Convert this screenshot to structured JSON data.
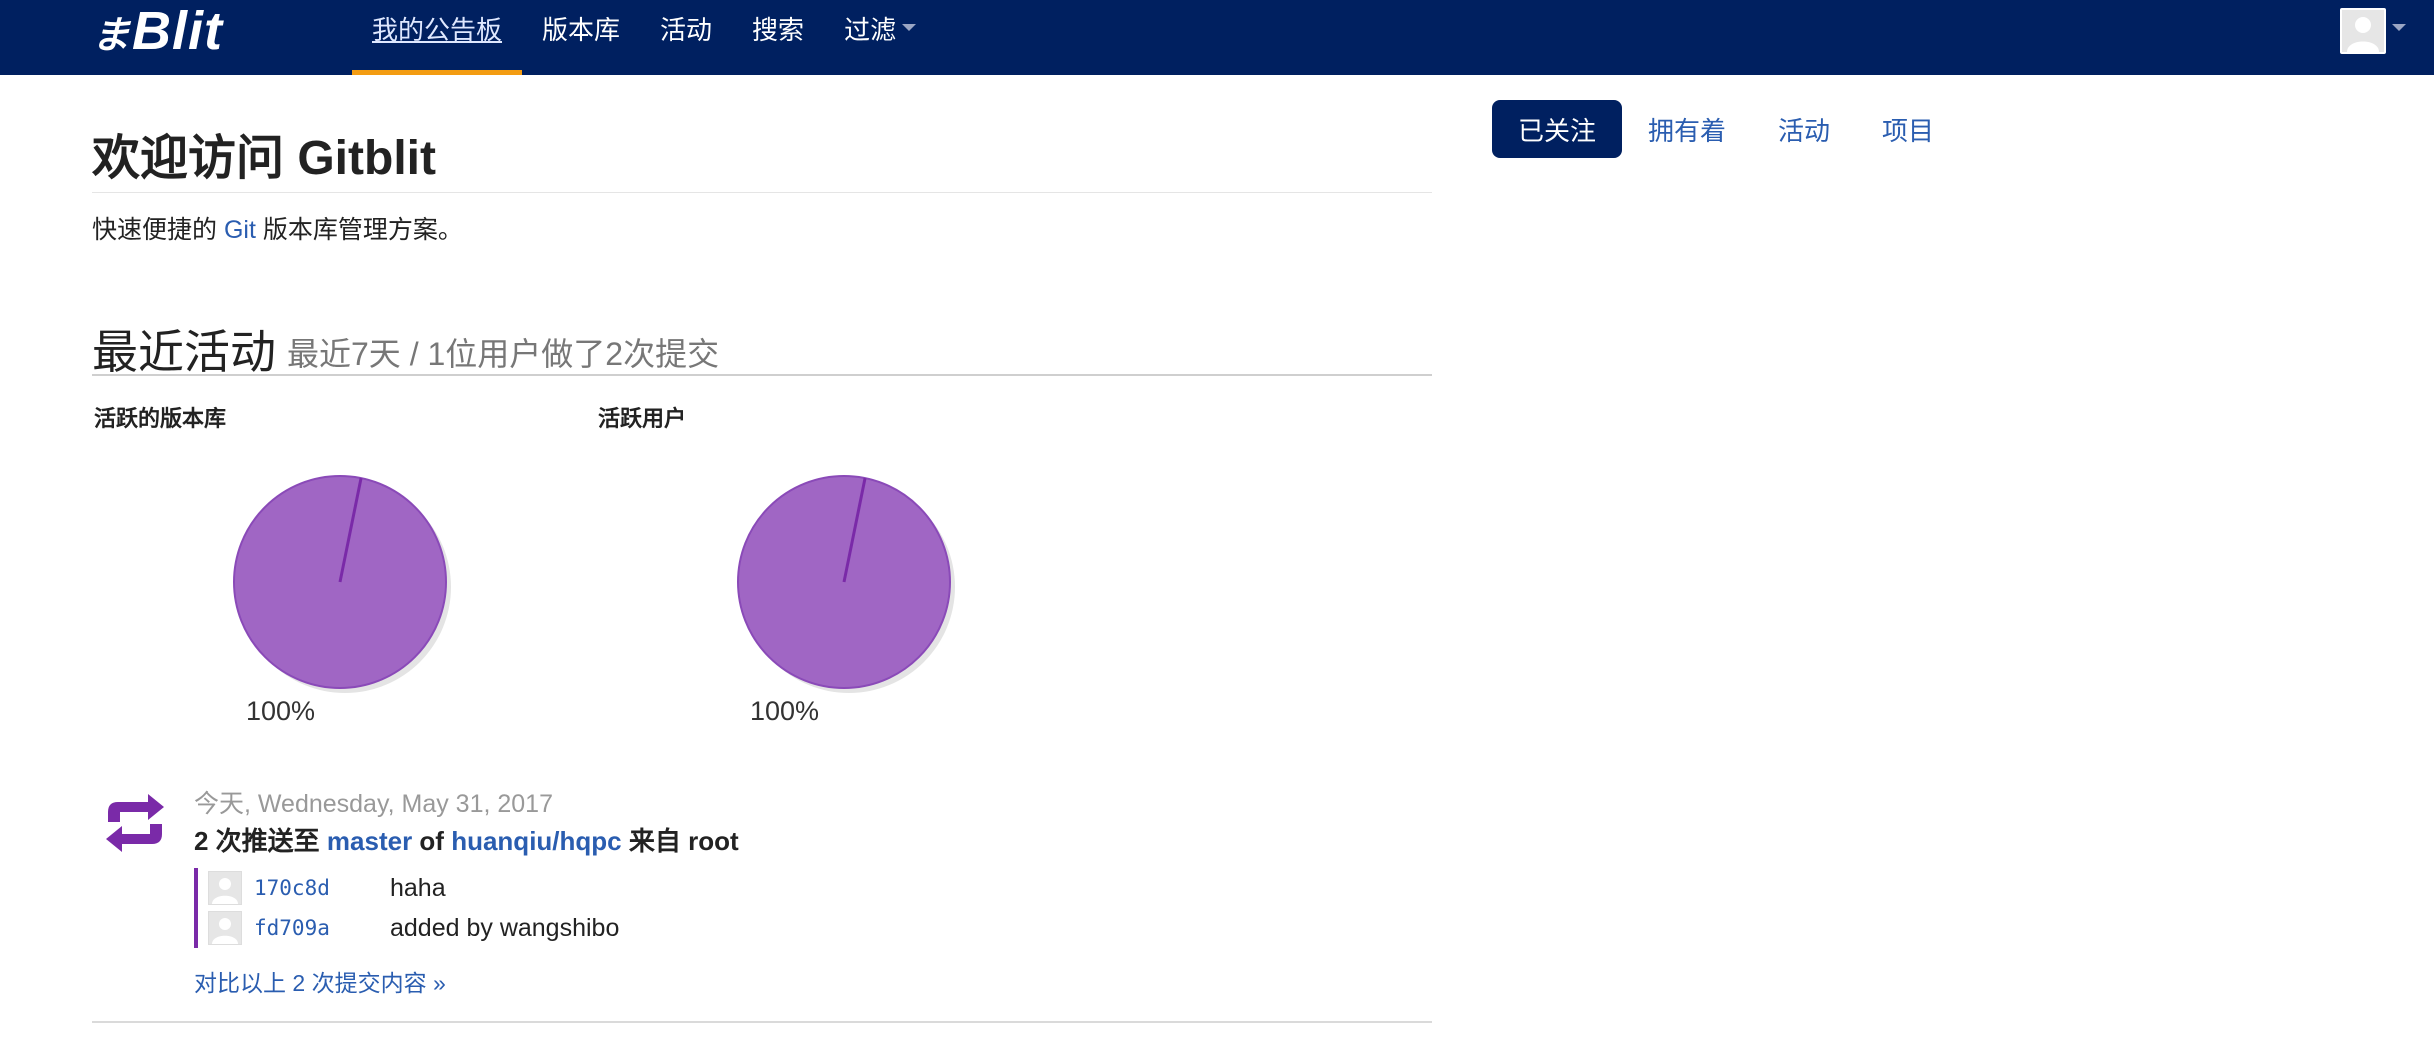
{
  "navbar": {
    "brand_mark": "ま",
    "brand_text": "Blit",
    "items": [
      {
        "label": "我的公告板",
        "active": true
      },
      {
        "label": "版本库"
      },
      {
        "label": "活动"
      },
      {
        "label": "搜索"
      },
      {
        "label": "过滤",
        "dropdown": true
      }
    ],
    "accent_color": "#f39c12",
    "background_color": "#002060"
  },
  "welcome": {
    "title": "欢迎访问 Gitblit",
    "tagline_pre": "快速便捷的 ",
    "tagline_link": "Git",
    "tagline_post": " 版本库管理方案。"
  },
  "activity": {
    "title": "最近活动",
    "subtitle": "最近7天 / 1位用户做了2次提交",
    "charts": [
      {
        "label": "活跃的版本库",
        "percent_label": "100%"
      },
      {
        "label": "活跃用户",
        "percent_label": "100%"
      }
    ]
  },
  "chart_data": [
    {
      "type": "pie",
      "title": "活跃的版本库",
      "values": [
        100
      ],
      "labels": [
        "100%"
      ],
      "colors": [
        "#a066c4"
      ]
    },
    {
      "type": "pie",
      "title": "活跃用户",
      "values": [
        100
      ],
      "labels": [
        "100%"
      ],
      "colors": [
        "#a066c4"
      ]
    }
  ],
  "event": {
    "icon": "push-icon",
    "date": "今天, Wednesday, May 31, 2017",
    "count_text": "2 次推送至 ",
    "branch": "master",
    "of": " of ",
    "repo": "huanqiu/hqpc",
    "from": " 来自 ",
    "user": "root",
    "commits": [
      {
        "sha": "170c8d",
        "message": "haha"
      },
      {
        "sha": "fd709a",
        "message": "added by wangshibo"
      }
    ],
    "compare_link": "对比以上 2 次提交内容 »"
  },
  "side_tabs": [
    {
      "label": "已关注",
      "active": true
    },
    {
      "label": "拥有着"
    },
    {
      "label": "活动"
    },
    {
      "label": "项目"
    }
  ]
}
